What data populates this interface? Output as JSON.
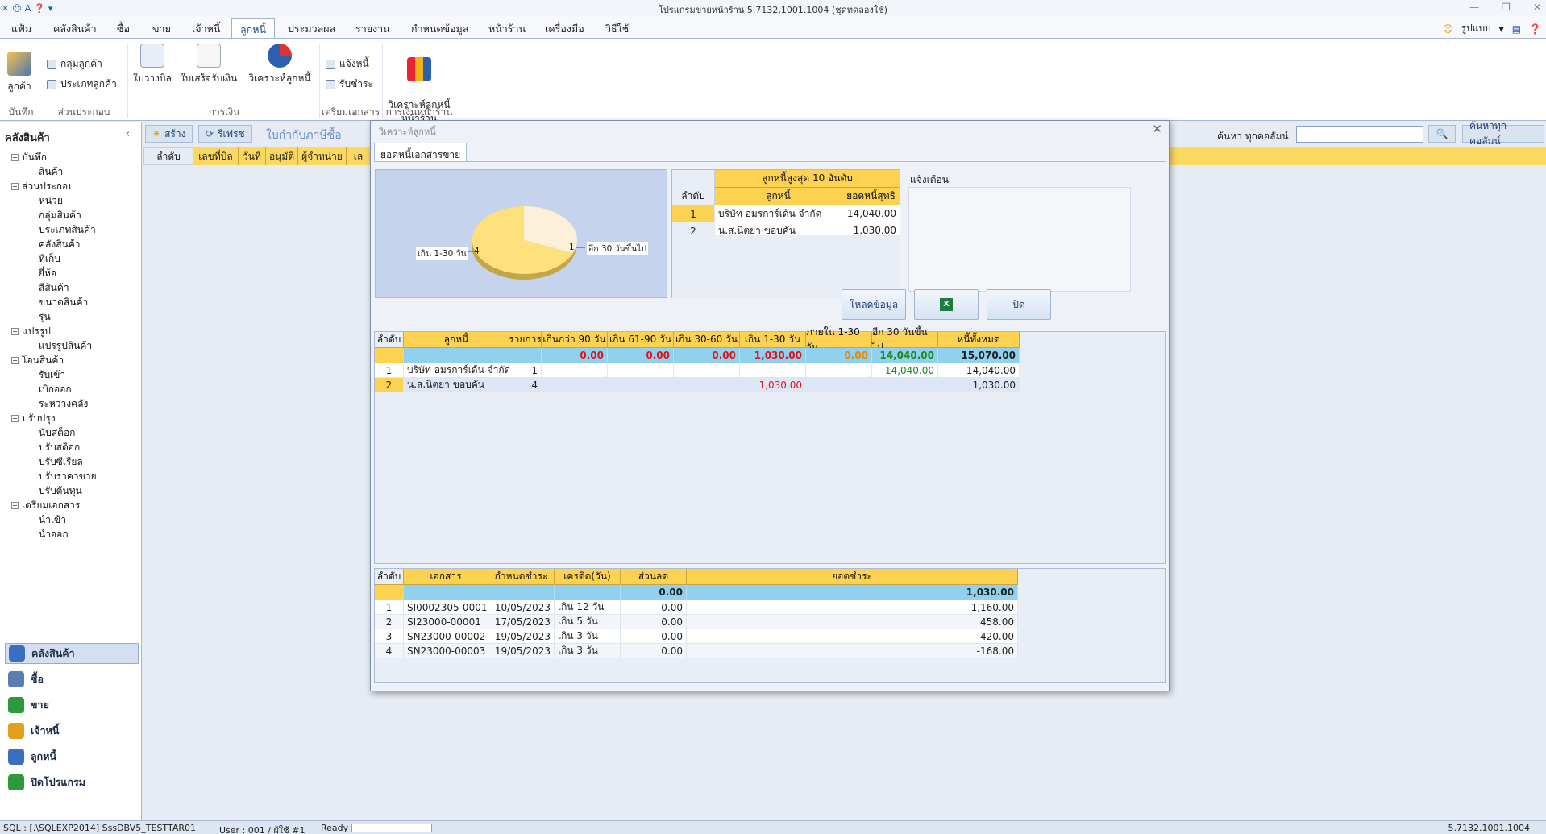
{
  "titlebar": {
    "title": "โปรแกรมขายหน้าร้าน 5.7132.1001.1004 (ชุดทดลองใช้)"
  },
  "menu": {
    "items": [
      "แฟ้ม",
      "คลังสินค้า",
      "ซื้อ",
      "ขาย",
      "เจ้าหนี้",
      "ลูกหนี้",
      "ประมวลผล",
      "รายงาน",
      "กำหนดข้อมูล",
      "หน้าร้าน",
      "เครื่องมือ",
      "วิธีใช้"
    ],
    "active": "ลูกหนี้",
    "right_label": "รูปแบบ"
  },
  "ribbon": {
    "customer_btn": "ลูกค้า",
    "customer_group_btn": "กลุ่มลูกค้า",
    "customer_type_btn": "ประเภทลูกค้า",
    "bill_btn": "ใบวางบิล",
    "receipt_btn": "ใบเสร็จรับเงิน",
    "analyze_btn": "วิเคราะห์ลูกหนี้",
    "notify_btn": "แจ้งหนี้",
    "receive_btn": "รับชำระ",
    "analyze_shop_btn": "วิเคราะห์ลูกหนี้\nหน้าร้าน",
    "groups": {
      "record": "บันทึก",
      "components": "ส่วนประกอบ",
      "finance": "การเงิน",
      "prepare": "เตรียมเอกสาร",
      "shop_finance": "การเงินหน้าร้าน"
    }
  },
  "left": {
    "title": "คลังสินค้า",
    "tree": [
      [
        "-",
        "บันทึก",
        0
      ],
      [
        "",
        "สินค้า",
        1
      ],
      [
        "-",
        "ส่วนประกอบ",
        0
      ],
      [
        "",
        "หน่วย",
        1
      ],
      [
        "",
        "กลุ่มสินค้า",
        1
      ],
      [
        "",
        "ประเภทสินค้า",
        1
      ],
      [
        "",
        "คลังสินค้า",
        1
      ],
      [
        "",
        "ที่เก็บ",
        1
      ],
      [
        "",
        "ยี่ห้อ",
        1
      ],
      [
        "",
        "สีสินค้า",
        1
      ],
      [
        "",
        "ขนาดสินค้า",
        1
      ],
      [
        "",
        "รุ่น",
        1
      ],
      [
        "-",
        "แปรรูป",
        0
      ],
      [
        "",
        "แปรรูปสินค้า",
        1
      ],
      [
        "-",
        "โอนสินค้า",
        0
      ],
      [
        "",
        "รับเข้า",
        1
      ],
      [
        "",
        "เบิกออก",
        1
      ],
      [
        "",
        "ระหว่างคลัง",
        1
      ],
      [
        "-",
        "ปรับปรุง",
        0
      ],
      [
        "",
        "นับสต็อก",
        1
      ],
      [
        "",
        "ปรับสต็อก",
        1
      ],
      [
        "",
        "ปรับซีเรียล",
        1
      ],
      [
        "",
        "ปรับราคาขาย",
        1
      ],
      [
        "",
        "ปรับต้นทุน",
        1
      ],
      [
        "-",
        "เตรียมเอกสาร",
        0
      ],
      [
        "",
        "นำเข้า",
        1
      ],
      [
        "",
        "นำออก",
        1
      ]
    ],
    "nav": [
      "คลังสินค้า",
      "ซื้อ",
      "ขาย",
      "เจ้าหนี้",
      "ลูกหนี้",
      "ปิดโปรแกรม"
    ]
  },
  "content": {
    "create_btn": "สร้าง",
    "refresh_btn": "รีเฟรช",
    "doc_title": "ใบกำกับภาษีซื้อ",
    "search_label": "ค้นหา ทุกคอลัมน์",
    "search_value": "",
    "search_all_btn": "ค้นหาทุกคอลัมน์",
    "cols": [
      "ลำดับ",
      "เลขที่บิล",
      "วันที่",
      "อนุมัติ",
      "ผู้จำหน่าย",
      "เล"
    ]
  },
  "dialog": {
    "title": "วิเคราะห์ลูกหนี้",
    "tab": "ยอดหนี้เอกสารขาย",
    "pie": {
      "label_left": "เกิน 1-30 วัน",
      "value_left": "4",
      "label_right": "อีก 30 วันขึ้นไป",
      "value_right": "1"
    },
    "top10": {
      "title": "ลูกหนี้สูงสุด 10 อันดับ",
      "col_no": "ลำดับ",
      "col_name": "ลูกหนี้",
      "col_amt": "ยอดหนี้สุทธิ",
      "rows": [
        [
          "1",
          "บริษัท อมรการ์เด้น จำกัด",
          "14,040.00"
        ],
        [
          "2",
          "น.ส.นิตยา  ขอบคัน",
          "1,030.00"
        ]
      ]
    },
    "alert": {
      "title": "แจ้งเตือน",
      "load_btn": "โหลดข้อมูล",
      "close_btn": "ปิด"
    },
    "aging": {
      "cols": [
        "ลำดับ",
        "ลูกหนี้",
        "รายการ",
        "เกินกว่า 90 วัน",
        "เกิน 61-90 วัน",
        "เกิน 30-60 วัน",
        "เกิน 1-30 วัน",
        "ภายใน 1-30 วัน",
        "อีก 30 วันขึ้นไป",
        "หนี้ทั้งหมด"
      ],
      "totals": [
        "",
        "",
        "",
        "0.00",
        "0.00",
        "0.00",
        "1,030.00",
        "0.00",
        "14,040.00",
        "15,070.00"
      ],
      "rows": [
        [
          "1",
          "บริษัท อมรการ์เด้น จำกัด",
          "1",
          "",
          "",
          "",
          "",
          "",
          "14,040.00",
          "14,040.00"
        ],
        [
          "2",
          "น.ส.นิตยา  ขอบคัน",
          "4",
          "",
          "",
          "",
          "1,030.00",
          "",
          "",
          "1,030.00"
        ]
      ]
    },
    "docs": {
      "cols": [
        "ลำดับ",
        "เอกสาร",
        "กำหนดชำระ",
        "เครดิต(วัน)",
        "ส่วนลด",
        "ยอดชำระ"
      ],
      "totals": [
        "",
        "",
        "",
        "",
        "0.00",
        "1,030.00"
      ],
      "rows": [
        [
          "1",
          "SI0002305-0001",
          "10/05/2023",
          "เกิน 12 วัน",
          "0.00",
          "1,160.00"
        ],
        [
          "2",
          "SI23000-00001",
          "17/05/2023",
          "เกิน 5 วัน",
          "0.00",
          "458.00"
        ],
        [
          "3",
          "SN23000-00002",
          "19/05/2023",
          "เกิน 3 วัน",
          "0.00",
          "-420.00"
        ],
        [
          "4",
          "SN23000-00003",
          "19/05/2023",
          "เกิน 3 วัน",
          "0.00",
          "-168.00"
        ]
      ]
    }
  },
  "status": {
    "sql": "SQL : [.\\SQLEXP2014] SssDBV5_TESTTAR01",
    "user": "User : 001 / ผู้ใช้ #1",
    "state": "Ready",
    "version": "5.7132.1001.1004"
  }
}
